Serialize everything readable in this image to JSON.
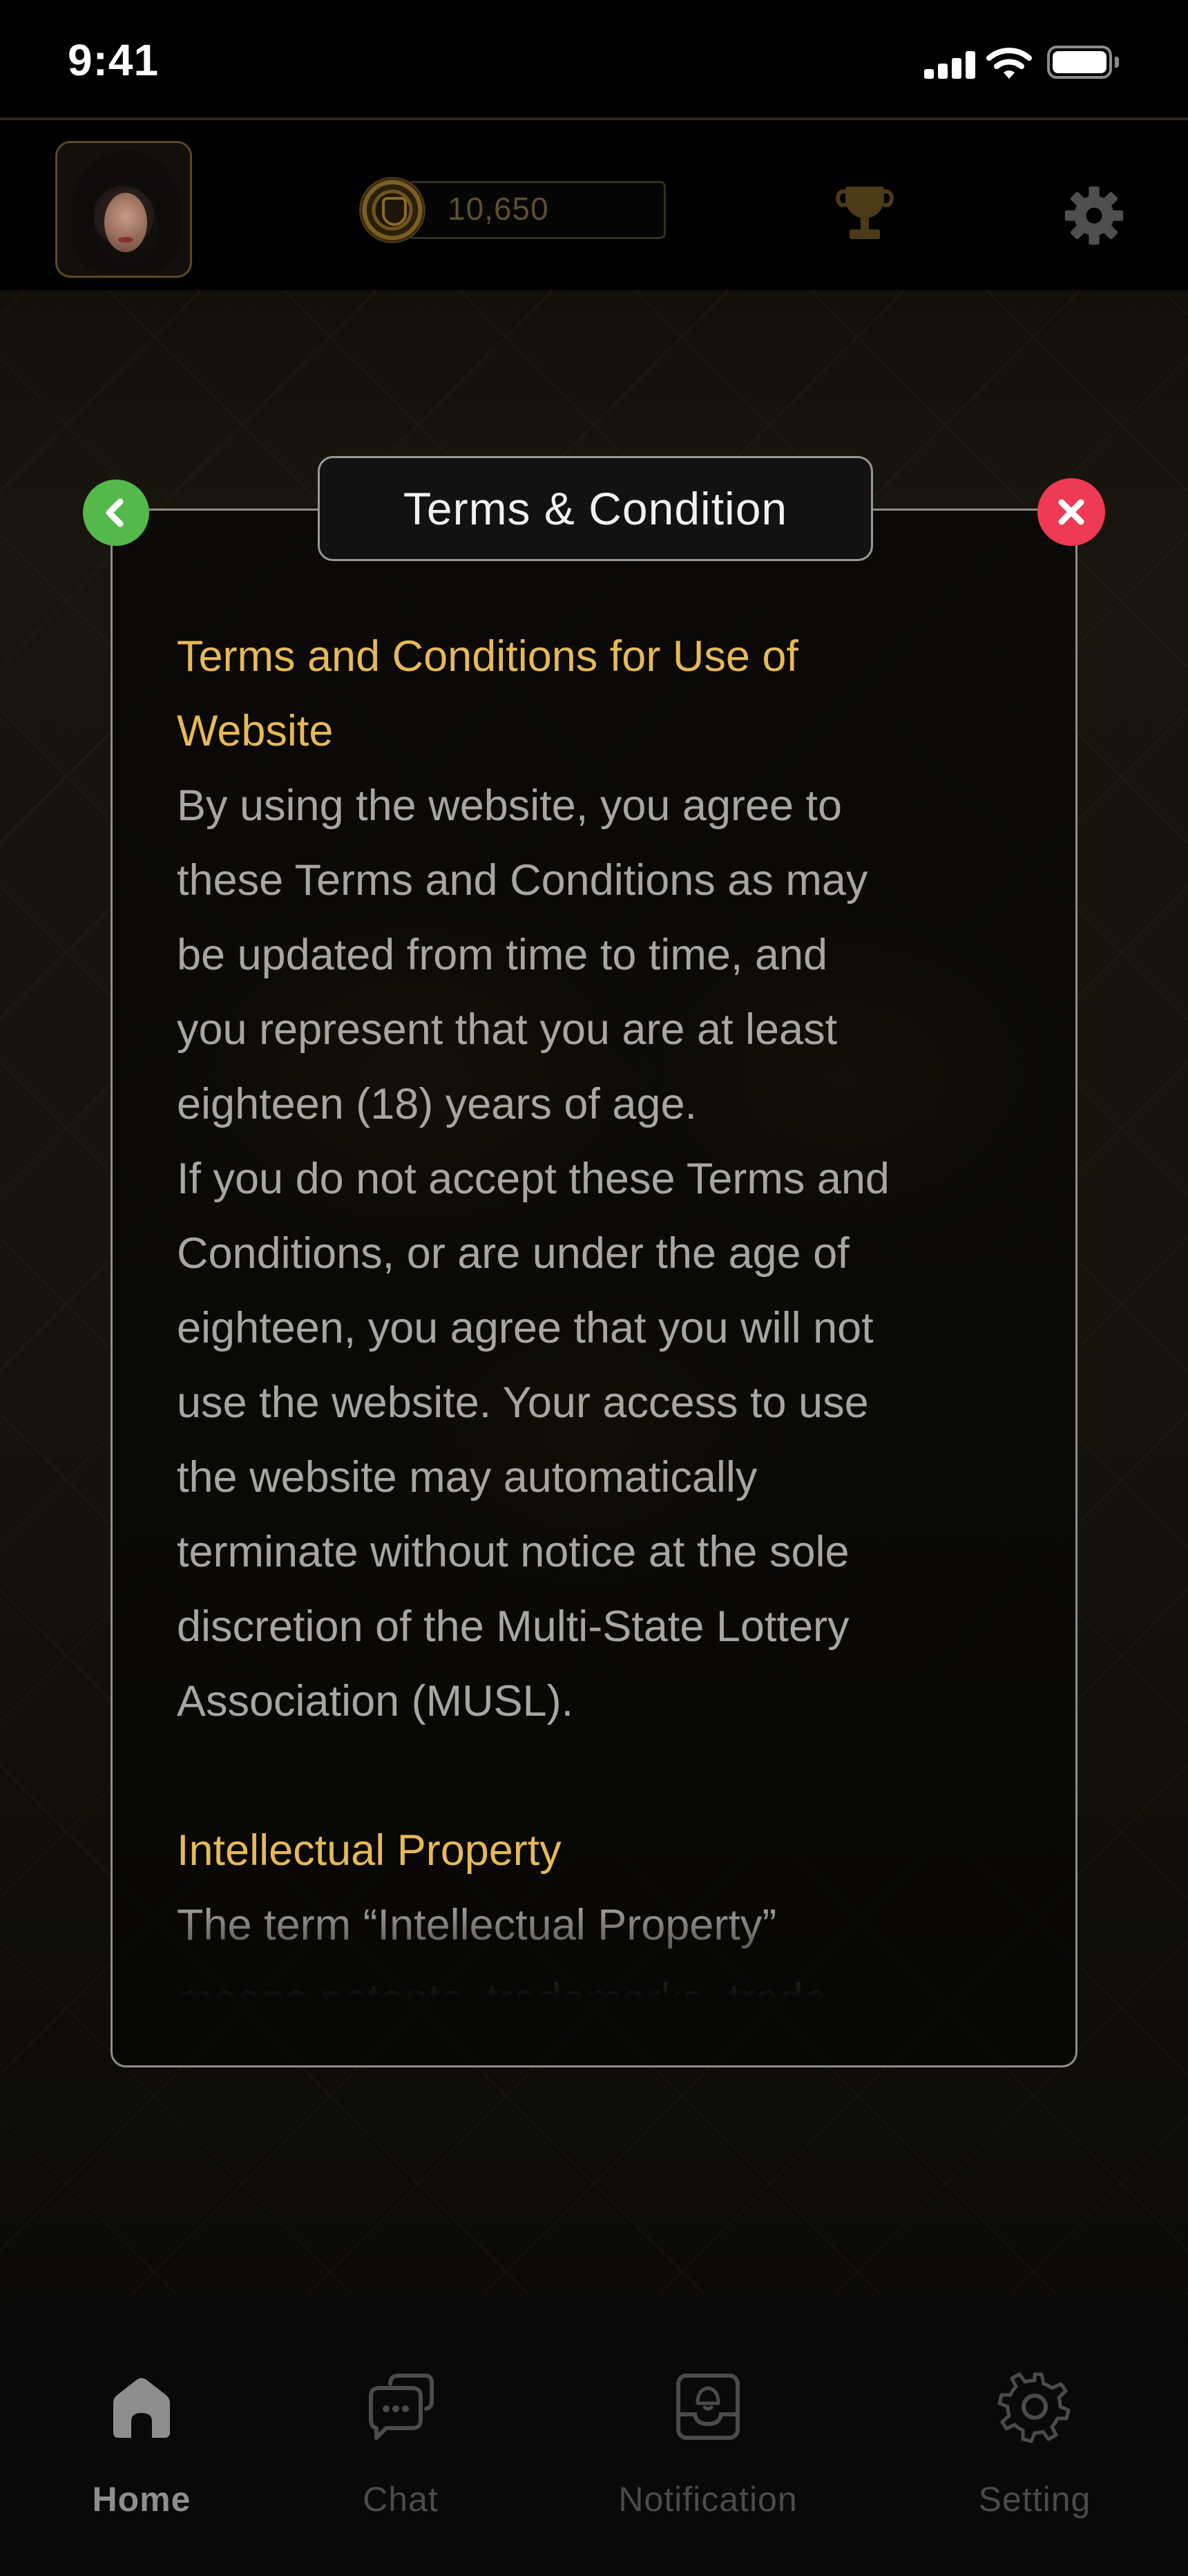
{
  "status_bar": {
    "time": "9:41"
  },
  "top_bar": {
    "coins": "10,650"
  },
  "modal": {
    "title": "Terms & Condition",
    "sections": [
      {
        "heading_lines": [
          "Terms and Conditions for Use of",
          "Website"
        ],
        "paragraph_lines": [
          "By using the website, you agree to",
          "these Terms and Conditions as may",
          "be updated from time to time, and",
          "you represent that you are at least",
          "eighteen (18) years of age.",
          "If you do not accept these Terms and",
          "Conditions, or are under the age of",
          "eighteen, you agree that you will not",
          "use the website. Your access to use",
          "the website may automatically",
          "terminate without notice at the sole",
          "discretion of the Multi-State Lottery",
          "Association (MUSL)."
        ]
      },
      {
        "heading_lines": [
          "Intellectual Property"
        ],
        "paragraph_lines": [
          "The term “Intellectual Property”",
          "means patents, trademarks, trade"
        ]
      }
    ]
  },
  "nav": {
    "items": [
      {
        "label": "Home",
        "icon": "home-icon",
        "active": true
      },
      {
        "label": "Chat",
        "icon": "chat-icon",
        "active": false
      },
      {
        "label": "Notification",
        "icon": "notification-icon",
        "active": false
      },
      {
        "label": "Setting",
        "icon": "settings-icon",
        "active": false
      }
    ]
  },
  "colors": {
    "accent_gold": "#e7b957",
    "back_green": "#54b84a",
    "close_red": "#ee3a55",
    "body_text": "#a8a6a1"
  }
}
